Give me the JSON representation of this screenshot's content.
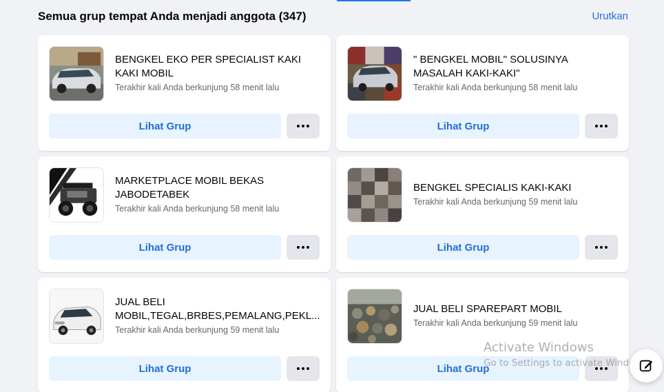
{
  "header": {
    "title": "Semua grup tempat Anda menjadi anggota (347)",
    "sort_label": "Urutkan"
  },
  "groups": [
    {
      "name": "BENGKEL EKO PER SPECIALIST KAKI KAKI MOBIL",
      "last_visit": "Terakhir kali Anda berkunjung 58 menit lalu",
      "view_label": "Lihat Grup",
      "thumb_icon": "car-workshop-photo"
    },
    {
      "name": "\" BENGKEL MOBIL\" SOLUSINYA MASALAH KAKI-KAKI\"",
      "last_visit": "Terakhir kali Anda berkunjung 58 menit lalu",
      "view_label": "Lihat Grup",
      "thumb_icon": "car-collage-photo"
    },
    {
      "name": "MARKETPLACE MOBIL BEKAS JABODETABEK",
      "last_visit": "Terakhir kali Anda berkunjung 58 menit lalu",
      "view_label": "Lihat Grup",
      "thumb_icon": "jeep-photo"
    },
    {
      "name": "BENGKEL SPECIALIS KAKI-KAKI",
      "last_visit": "Terakhir kali Anda berkunjung 59 menit lalu",
      "view_label": "Lihat Grup",
      "thumb_icon": "parts-grid-photo"
    },
    {
      "name": "JUAL BELI MOBIL,TEGAL,BRBES,PEMALANG,PEKL...",
      "last_visit": "Terakhir kali Anda berkunjung 59 menit lalu",
      "view_label": "Lihat Grup",
      "thumb_icon": "white-mpv-photo"
    },
    {
      "name": "JUAL BELI SPAREPART MOBIL",
      "last_visit": "Terakhir kali Anda berkunjung 59 menit lalu",
      "view_label": "Lihat Grup",
      "thumb_icon": "spare-parts-photo"
    }
  ],
  "watermark": {
    "title": "Activate Windows",
    "subtitle": "Go to Settings to activate Windows."
  },
  "compose_icon": "compose-icon",
  "colors": {
    "background": "#f0f2f5",
    "card": "#ffffff",
    "accent": "#1877f2",
    "link": "#216fdb",
    "primary_button_bg": "#e7f3ff",
    "secondary_button_bg": "#e4e6eb",
    "secondary_text": "#65676b"
  }
}
